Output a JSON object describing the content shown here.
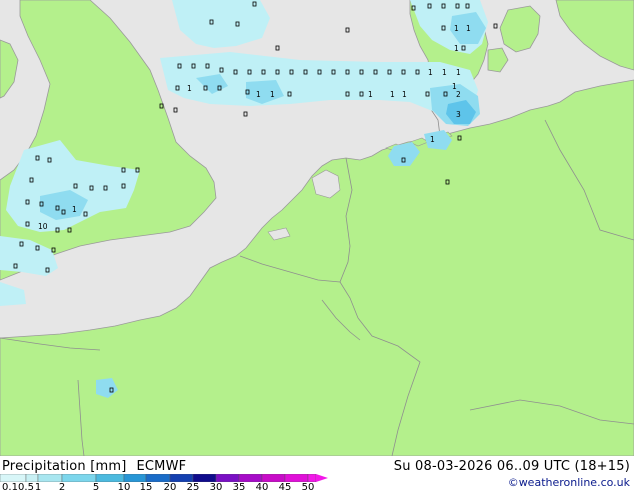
{
  "product": {
    "title": "Precipitation [mm]",
    "model": "ECMWF",
    "datetime": "Su 08-03-2026 06..09 UTC (18+15)",
    "credit": "©weatheronline.co.uk"
  },
  "legend": {
    "ticks": [
      "0.1",
      "0.5",
      "1",
      "2",
      "5",
      "10",
      "15",
      "20",
      "25",
      "30",
      "35",
      "40",
      "45",
      "50"
    ],
    "colors": [
      "#d8f6f8",
      "#c8f0f4",
      "#a8e6f0",
      "#7cd6ec",
      "#4cbadf",
      "#2896d6",
      "#1a6cc8",
      "#1440b0",
      "#100c8c",
      "#7a10c4",
      "#a60cc8",
      "#c80cc8",
      "#e010d8",
      "#f218e8"
    ]
  },
  "colors": {
    "land": "#b4f08c",
    "sea": "#e6e6e6",
    "border": "#8f8f8f",
    "precip_light": "#bff0f6",
    "precip_medium": "#8fdcf0",
    "precip_heavy": "#5ec4ea"
  },
  "values": [
    {
      "id": "v1",
      "text": "1"
    },
    {
      "id": "v2",
      "text": "1"
    },
    {
      "id": "v3",
      "text": "1"
    },
    {
      "id": "v4",
      "text": "1"
    },
    {
      "id": "v5",
      "text": "1"
    },
    {
      "id": "v6",
      "text": "1"
    },
    {
      "id": "v7",
      "text": "1"
    },
    {
      "id": "v8",
      "text": "1"
    },
    {
      "id": "v9",
      "text": "1"
    },
    {
      "id": "v10",
      "text": "1"
    },
    {
      "id": "v11",
      "text": "1"
    },
    {
      "id": "v12",
      "text": "1"
    },
    {
      "id": "v13",
      "text": "1"
    },
    {
      "id": "v14",
      "text": "1"
    },
    {
      "id": "v15",
      "text": "10"
    },
    {
      "id": "v16",
      "text": "3"
    },
    {
      "id": "v17",
      "text": "2"
    },
    {
      "id": "v18",
      "text": "1"
    }
  ]
}
